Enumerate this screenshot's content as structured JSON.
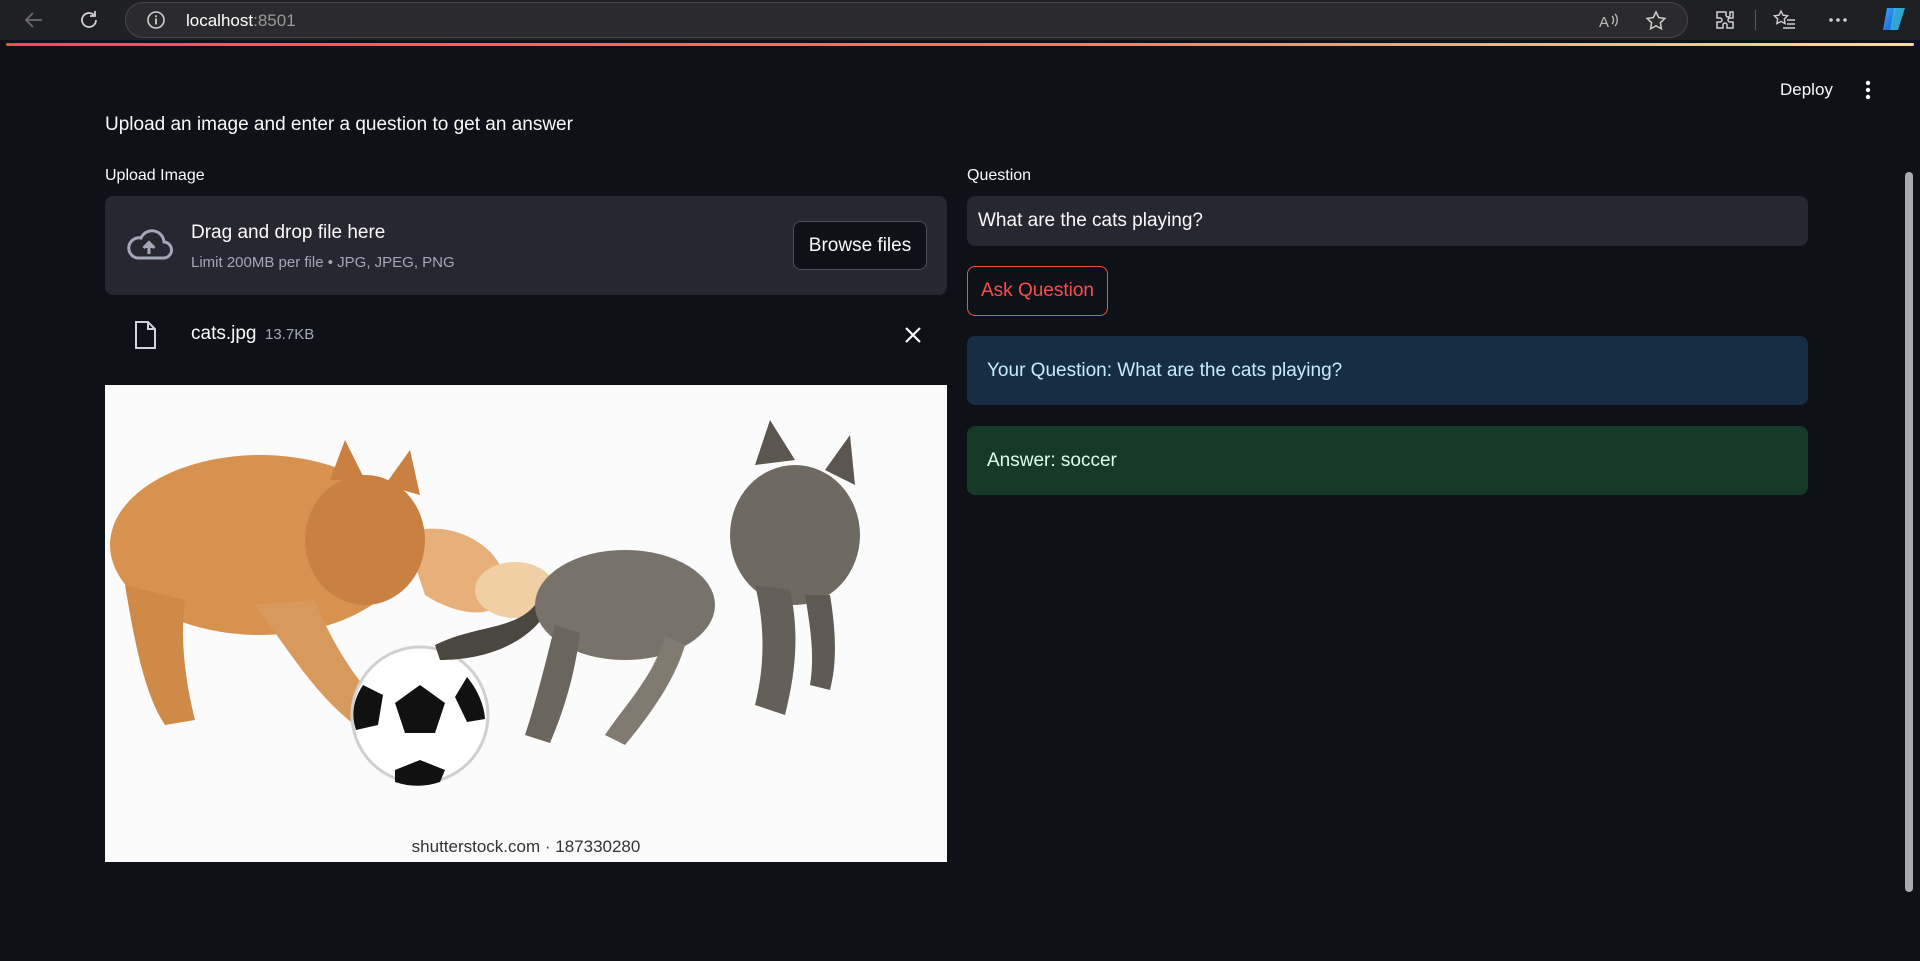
{
  "browser": {
    "url_host": "localhost",
    "url_port": ":8501"
  },
  "header": {
    "deploy_label": "Deploy"
  },
  "main": {
    "intro_text": "Upload an image and enter a question to get an answer"
  },
  "uploader": {
    "label": "Upload Image",
    "drop_title": "Drag and drop file here",
    "drop_subtitle": "Limit 200MB per file • JPG, JPEG, PNG",
    "browse_label": "Browse files",
    "file": {
      "name": "cats.jpg",
      "size": "13.7KB"
    }
  },
  "image": {
    "watermark": "shutterstock.com · 187330280"
  },
  "question": {
    "label": "Question",
    "value": "What are the cats playing?",
    "ask_label": "Ask Question"
  },
  "results": {
    "question_echo": "Your Question: What are the cats playing?",
    "answer": "Answer: soccer"
  },
  "colors": {
    "background": "#0e1117",
    "widget_bg": "#262730",
    "accent_red": "#ff4b4b",
    "info_bg": "#172d43",
    "success_bg": "#173928"
  }
}
